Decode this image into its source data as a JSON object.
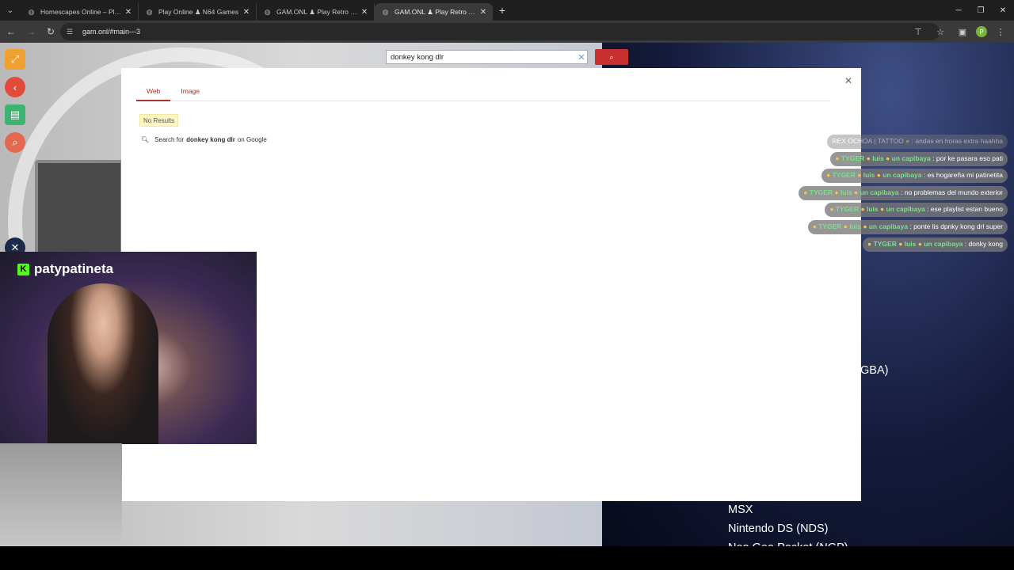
{
  "browser": {
    "tabs": [
      {
        "title": "Homescapes Online – Play Free",
        "active": false
      },
      {
        "title": "Play Online ♟ N64 Games",
        "active": false
      },
      {
        "title": "GAM.ONL ♟ Play Retro Games",
        "active": false
      },
      {
        "title": "GAM.ONL ♟ Play Retro Games",
        "active": true
      }
    ],
    "url": "gam.onl/#main---3",
    "profile_initial": "P"
  },
  "search": {
    "query": "donkey kong dlr",
    "go_icon": "search-icon"
  },
  "results": {
    "tabs": [
      "Web",
      "Image"
    ],
    "no_results": "No Results",
    "google_prefix": "Search for",
    "google_query": "donkey kong dlr",
    "google_suffix": "on Google"
  },
  "chat": [
    {
      "user": "REX OCHOA | TATTOO",
      "msg": ": andas en horas extra haahha",
      "faded": true
    },
    {
      "user": "TYGER",
      "extra": "luis",
      "name2": "un capibaya",
      "msg": ": por ke pasara eso pati"
    },
    {
      "user": "TYGER",
      "extra": "luis",
      "name2": "un capibaya",
      "msg": ": es hogareña mi patinetita"
    },
    {
      "user": "TYGER",
      "extra": "luis",
      "name2": "un capibaya",
      "msg": ": no problemas del mundo exterior"
    },
    {
      "user": "TYGER",
      "extra": "luis",
      "name2": "un capibaya",
      "msg": ": ese playlist estan bueno"
    },
    {
      "user": "TYGER",
      "extra": "luis",
      "name2": "un capibaya",
      "msg": ": ponte lis dpnky kong drl super"
    },
    {
      "user": "TYGER",
      "extra": "luis",
      "name2": "un capibaya",
      "msg": ": donky kong"
    }
  ],
  "stream": {
    "channel": "patypatineta"
  },
  "background_list": [
    "GBA)",
    "MSX",
    "Nintendo DS (NDS)",
    "Neo Geo Pocket (NGP)"
  ]
}
